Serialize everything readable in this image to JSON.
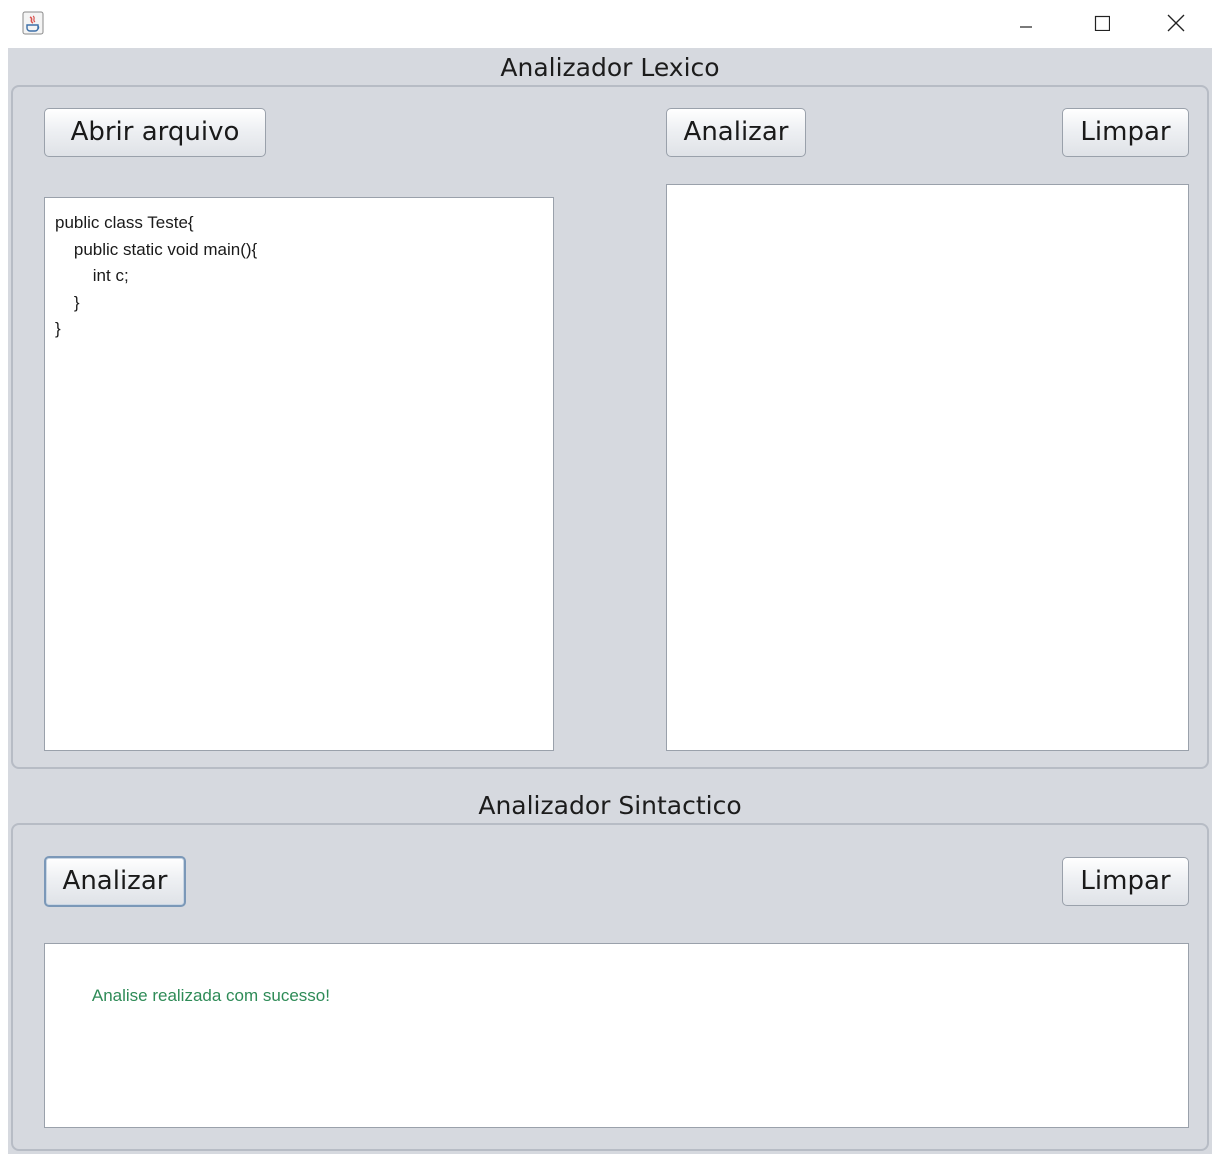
{
  "window": {
    "icon": "java-app-icon",
    "controls": {
      "minimize": "minimize-icon",
      "maximize": "maximize-icon",
      "close": "close-icon"
    }
  },
  "lexico": {
    "title": "Analizador Lexico",
    "open_file_label": "Abrir arquivo",
    "analyze_label": "Analizar",
    "clear_label": "Limpar",
    "source_code": "public class Teste{\n    public static void main(){\n        int c;\n    }\n}",
    "output": ""
  },
  "sintactico": {
    "title": "Analizador Sintactico",
    "analyze_label": "Analizar",
    "clear_label": "Limpar",
    "output": "Analise realizada com sucesso!",
    "output_color": "#2e8b57"
  },
  "colors": {
    "background": "#d6d9df",
    "panel_border": "#b7bcc5",
    "success": "#2e8b57"
  }
}
